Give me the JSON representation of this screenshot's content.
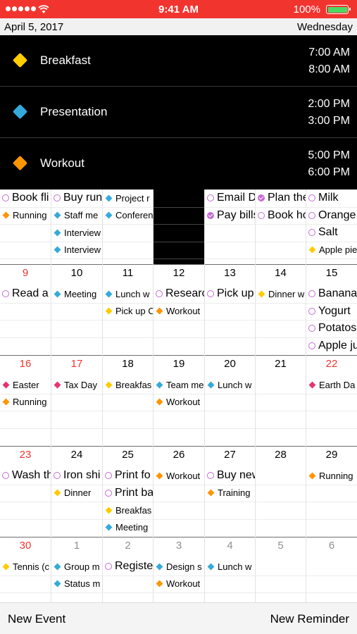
{
  "status_bar": {
    "time": "9:41 AM",
    "battery": "100%",
    "battery_level": 1.0,
    "signal_dots": 5,
    "color": "#f2342f"
  },
  "date_bar": {
    "date": "April 5, 2017",
    "weekday": "Wednesday"
  },
  "events": [
    {
      "title": "Breakfast",
      "start": "7:00 AM",
      "end": "8:00 AM",
      "color": "#ffcc00"
    },
    {
      "title": "Presentation",
      "start": "2:00 PM",
      "end": "3:00 PM",
      "color": "#34aadc"
    },
    {
      "title": "Workout",
      "start": "5:00 PM",
      "end": "6:00 PM",
      "color": "#ff9500"
    }
  ],
  "colors": {
    "yellow": "#ffcc00",
    "blue": "#34aadc",
    "orange": "#ff9500",
    "pink": "#e8336d",
    "reminder": "#c56bd3",
    "weekend_red": "#f2342f"
  },
  "calendar": {
    "weeks": [
      {
        "days": [
          {
            "num": "",
            "items": [
              {
                "kind": "circle",
                "text": "Book fli"
              },
              {
                "kind": "diamond",
                "color": "orange",
                "text": "Running"
              }
            ]
          },
          {
            "num": "",
            "items": [
              {
                "kind": "circle",
                "text": "Buy run"
              },
              {
                "kind": "diamond",
                "color": "blue",
                "text": "Staff me"
              },
              {
                "kind": "diamond",
                "color": "blue",
                "text": "Interview"
              },
              {
                "kind": "diamond",
                "color": "blue",
                "text": "Interview"
              }
            ]
          },
          {
            "num": "",
            "items": [
              {
                "kind": "diamond",
                "color": "blue",
                "text": "Project r"
              },
              {
                "kind": "diamond",
                "color": "blue",
                "text": "Conferen"
              }
            ]
          },
          {
            "num": "",
            "today": true,
            "items": []
          },
          {
            "num": "",
            "items": [
              {
                "kind": "circle",
                "text": "Email D"
              },
              {
                "kind": "check",
                "text": "Pay bills"
              }
            ]
          },
          {
            "num": "",
            "items": [
              {
                "kind": "check",
                "text": "Plan the"
              },
              {
                "kind": "circle",
                "text": "Book ho"
              }
            ]
          },
          {
            "num": "",
            "items": [
              {
                "kind": "circle",
                "text": "Milk"
              },
              {
                "kind": "circle",
                "text": "Orange"
              },
              {
                "kind": "circle",
                "text": "Salt"
              },
              {
                "kind": "diamond",
                "color": "yellow",
                "text": "Apple pie"
              }
            ]
          }
        ]
      },
      {
        "days": [
          {
            "num": "9",
            "red": true,
            "items": [
              {
                "kind": "circle",
                "text": "Read a"
              }
            ]
          },
          {
            "num": "10",
            "items": [
              {
                "kind": "diamond",
                "color": "blue",
                "text": "Meeting"
              }
            ]
          },
          {
            "num": "11",
            "items": [
              {
                "kind": "diamond",
                "color": "blue",
                "text": "Lunch w"
              },
              {
                "kind": "diamond",
                "color": "yellow",
                "text": "Pick up C"
              }
            ]
          },
          {
            "num": "12",
            "items": [
              {
                "kind": "circle",
                "text": "Researc"
              },
              {
                "kind": "diamond",
                "color": "orange",
                "text": "Workout"
              }
            ]
          },
          {
            "num": "13",
            "items": [
              {
                "kind": "circle",
                "text": "Pick up"
              }
            ]
          },
          {
            "num": "14",
            "items": [
              {
                "kind": "diamond",
                "color": "yellow",
                "text": "Dinner w"
              }
            ]
          },
          {
            "num": "15",
            "items": [
              {
                "kind": "circle",
                "text": "Banana"
              },
              {
                "kind": "circle",
                "text": "Yogurt"
              },
              {
                "kind": "circle",
                "text": "Potatos"
              },
              {
                "kind": "circle",
                "text": "Apple ju"
              }
            ]
          }
        ]
      },
      {
        "days": [
          {
            "num": "16",
            "red": true,
            "items": [
              {
                "kind": "diamond",
                "color": "pink",
                "text": "Easter"
              },
              {
                "kind": "diamond",
                "color": "orange",
                "text": "Running"
              }
            ]
          },
          {
            "num": "17",
            "red": true,
            "items": [
              {
                "kind": "diamond",
                "color": "pink",
                "text": "Tax Day"
              }
            ]
          },
          {
            "num": "18",
            "items": [
              {
                "kind": "diamond",
                "color": "yellow",
                "text": "Breakfas"
              }
            ]
          },
          {
            "num": "19",
            "items": [
              {
                "kind": "diamond",
                "color": "blue",
                "text": "Team me"
              },
              {
                "kind": "diamond",
                "color": "orange",
                "text": "Workout"
              }
            ]
          },
          {
            "num": "20",
            "items": [
              {
                "kind": "diamond",
                "color": "blue",
                "text": "Lunch w"
              }
            ]
          },
          {
            "num": "21",
            "items": []
          },
          {
            "num": "22",
            "red": true,
            "items": [
              {
                "kind": "diamond",
                "color": "pink",
                "text": "Earth Da"
              }
            ]
          }
        ]
      },
      {
        "days": [
          {
            "num": "23",
            "red": true,
            "items": [
              {
                "kind": "circle",
                "text": "Wash th"
              }
            ]
          },
          {
            "num": "24",
            "items": [
              {
                "kind": "circle",
                "text": "Iron shi"
              },
              {
                "kind": "diamond",
                "color": "yellow",
                "text": "Dinner"
              }
            ]
          },
          {
            "num": "25",
            "items": [
              {
                "kind": "circle",
                "text": "Print fo"
              },
              {
                "kind": "circle",
                "text": "Print ba"
              },
              {
                "kind": "diamond",
                "color": "yellow",
                "text": "Breakfas"
              },
              {
                "kind": "diamond",
                "color": "blue",
                "text": "Meeting"
              }
            ]
          },
          {
            "num": "26",
            "items": [
              {
                "kind": "diamond",
                "color": "orange",
                "text": "Workout"
              }
            ]
          },
          {
            "num": "27",
            "items": [
              {
                "kind": "circle",
                "text": "Buy new"
              },
              {
                "kind": "diamond",
                "color": "orange",
                "text": "Training"
              }
            ]
          },
          {
            "num": "28",
            "items": []
          },
          {
            "num": "29",
            "items": [
              {
                "kind": "diamond",
                "color": "orange",
                "text": "Running"
              }
            ]
          }
        ]
      },
      {
        "days": [
          {
            "num": "30",
            "red": true,
            "items": [
              {
                "kind": "diamond",
                "color": "yellow",
                "text": "Tennis (c"
              }
            ]
          },
          {
            "num": "1",
            "gray": true,
            "items": [
              {
                "kind": "diamond",
                "color": "blue",
                "text": "Group m"
              },
              {
                "kind": "diamond",
                "color": "blue",
                "text": "Status m"
              }
            ]
          },
          {
            "num": "2",
            "gray": true,
            "items": [
              {
                "kind": "circle",
                "text": "Registe"
              }
            ]
          },
          {
            "num": "3",
            "gray": true,
            "items": [
              {
                "kind": "diamond",
                "color": "blue",
                "text": "Design s"
              },
              {
                "kind": "diamond",
                "color": "orange",
                "text": "Workout"
              }
            ]
          },
          {
            "num": "4",
            "gray": true,
            "items": [
              {
                "kind": "diamond",
                "color": "blue",
                "text": "Lunch w"
              }
            ]
          },
          {
            "num": "5",
            "gray": true,
            "items": []
          },
          {
            "num": "6",
            "gray": true,
            "items": []
          }
        ]
      }
    ]
  },
  "bottom_bar": {
    "new_event": "New Event",
    "new_reminder": "New Reminder"
  }
}
